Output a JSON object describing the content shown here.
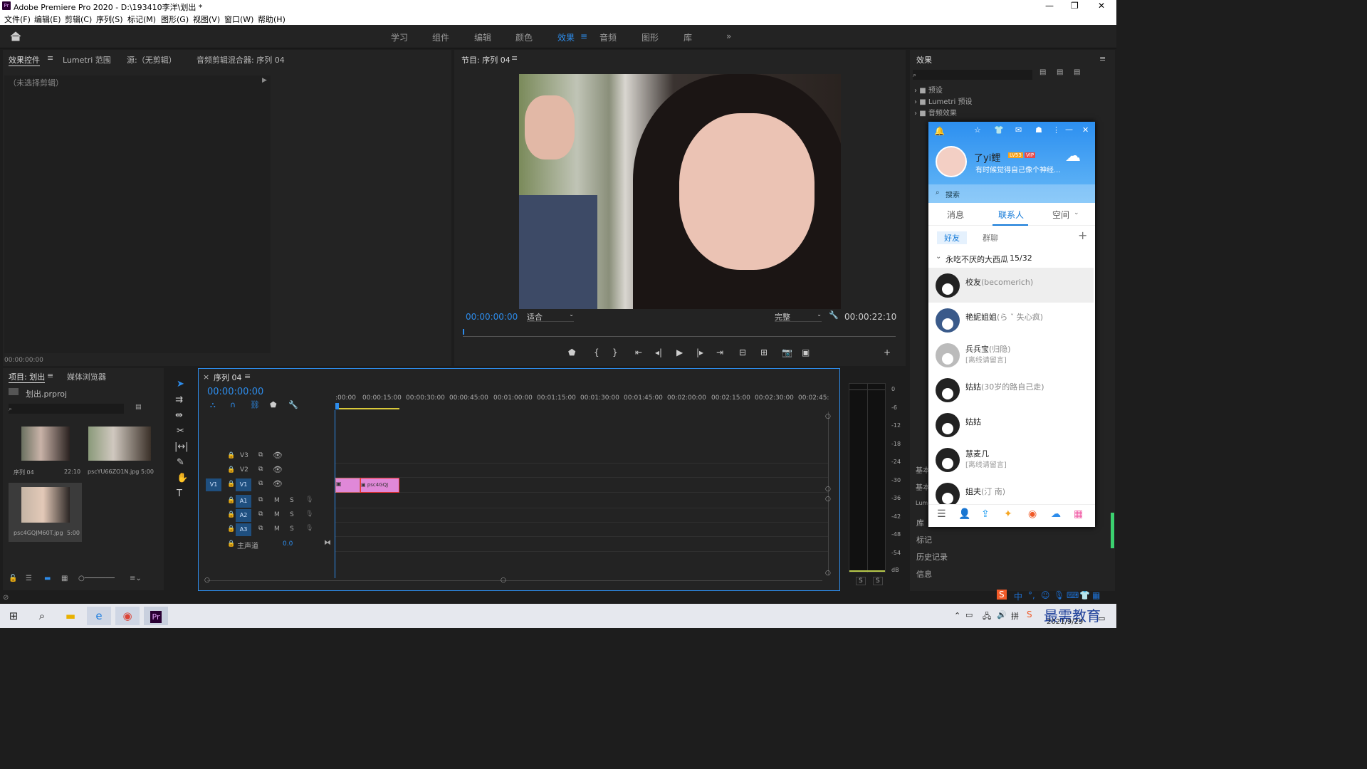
{
  "window": {
    "title": "Adobe Premiere Pro 2020 - D:\\193410李洋\\划出 *",
    "app_icon": "Pr"
  },
  "menu": [
    "文件(F)",
    "编辑(E)",
    "剪辑(C)",
    "序列(S)",
    "标记(M)",
    "图形(G)",
    "视图(V)",
    "窗口(W)",
    "帮助(H)"
  ],
  "workspaces": [
    "学习",
    "组件",
    "编辑",
    "颜色",
    "效果",
    "音频",
    "图形",
    "库"
  ],
  "effect_controls": {
    "tabs": [
      "效果控件",
      "Lumetri 范围",
      "源:（无剪辑）",
      "音频剪辑混合器: 序列 04"
    ],
    "no_clip": "（未选择剪辑）",
    "time": "00:00:00:00"
  },
  "program": {
    "title": "节目: 序列 04",
    "timecode": "00:00:00:00",
    "fit": "适合",
    "quality": "完整",
    "duration": "00:00:22:10"
  },
  "project": {
    "tabs": [
      "项目: 划出",
      "媒体浏览器"
    ],
    "file": "划出.prproj",
    "items": [
      {
        "name": "序列 04",
        "dur": "22:10"
      },
      {
        "name": "pscYU66ZO1N.jpg",
        "dur": "5:00"
      },
      {
        "name": "psc4GQJM60T.jpg",
        "dur": "5:00"
      }
    ]
  },
  "timeline": {
    "title": "序列 04",
    "timecode": "00:00:00:00",
    "ruler": [
      ":00:00",
      "00:00:15:00",
      "00:00:30:00",
      "00:00:45:00",
      "00:01:00:00",
      "00:01:15:00",
      "00:01:30:00",
      "00:01:45:00",
      "00:02:00:00",
      "00:02:15:00",
      "00:02:30:00",
      "00:02:45:"
    ],
    "video_tracks": [
      "V3",
      "V2",
      "V1"
    ],
    "audio_tracks": [
      "A1",
      "A2",
      "A3"
    ],
    "master": "主声道",
    "master_val": "0.0",
    "src_patch": "V1",
    "clip_label": "psc4GQJ"
  },
  "meter": {
    "labels": [
      "0",
      "-6",
      "-12",
      "-18",
      "-24",
      "-30",
      "-36",
      "-42",
      "-48",
      "-54",
      "dB"
    ],
    "solo": [
      "S",
      "S"
    ]
  },
  "effects": {
    "title": "效果",
    "items": [
      "预设",
      "Lumetri 预设",
      "音频效果"
    ],
    "bottom": [
      "基本",
      "基本",
      "Lum",
      "库",
      "标记",
      "历史记录",
      "信息"
    ]
  },
  "qq": {
    "name": "了yi鲤",
    "badges": [
      "LV53",
      "VIP"
    ],
    "status": "有时候觉得自己像个神经...",
    "search": "搜索",
    "tabs": [
      "消息",
      "联系人",
      "空间"
    ],
    "subtabs": [
      "好友",
      "群聊"
    ],
    "group": "永吃不厌的大西瓜",
    "group_count": "15/32",
    "contacts": [
      {
        "name": "校友",
        "note": "(becomerich)",
        "sub": ""
      },
      {
        "name": "艳妮姐姐",
        "note": "(ら ˇ 失心疯)",
        "sub": ""
      },
      {
        "name": "兵兵宝",
        "note": "(归隐)",
        "sub": "[离线请留言]"
      },
      {
        "name": "姑姑",
        "note": "(30岁的路自己走)",
        "sub": ""
      },
      {
        "name": "姑姑",
        "note": "",
        "sub": ""
      },
      {
        "name": "慧麦几",
        "note": "",
        "sub": "[离线请留言]"
      },
      {
        "name": "姐夫",
        "note": "(汀 南)",
        "sub": ""
      }
    ]
  },
  "taskbar": {
    "date": "2021/9/29",
    "watermark": "最需教育",
    "ime": "中"
  }
}
